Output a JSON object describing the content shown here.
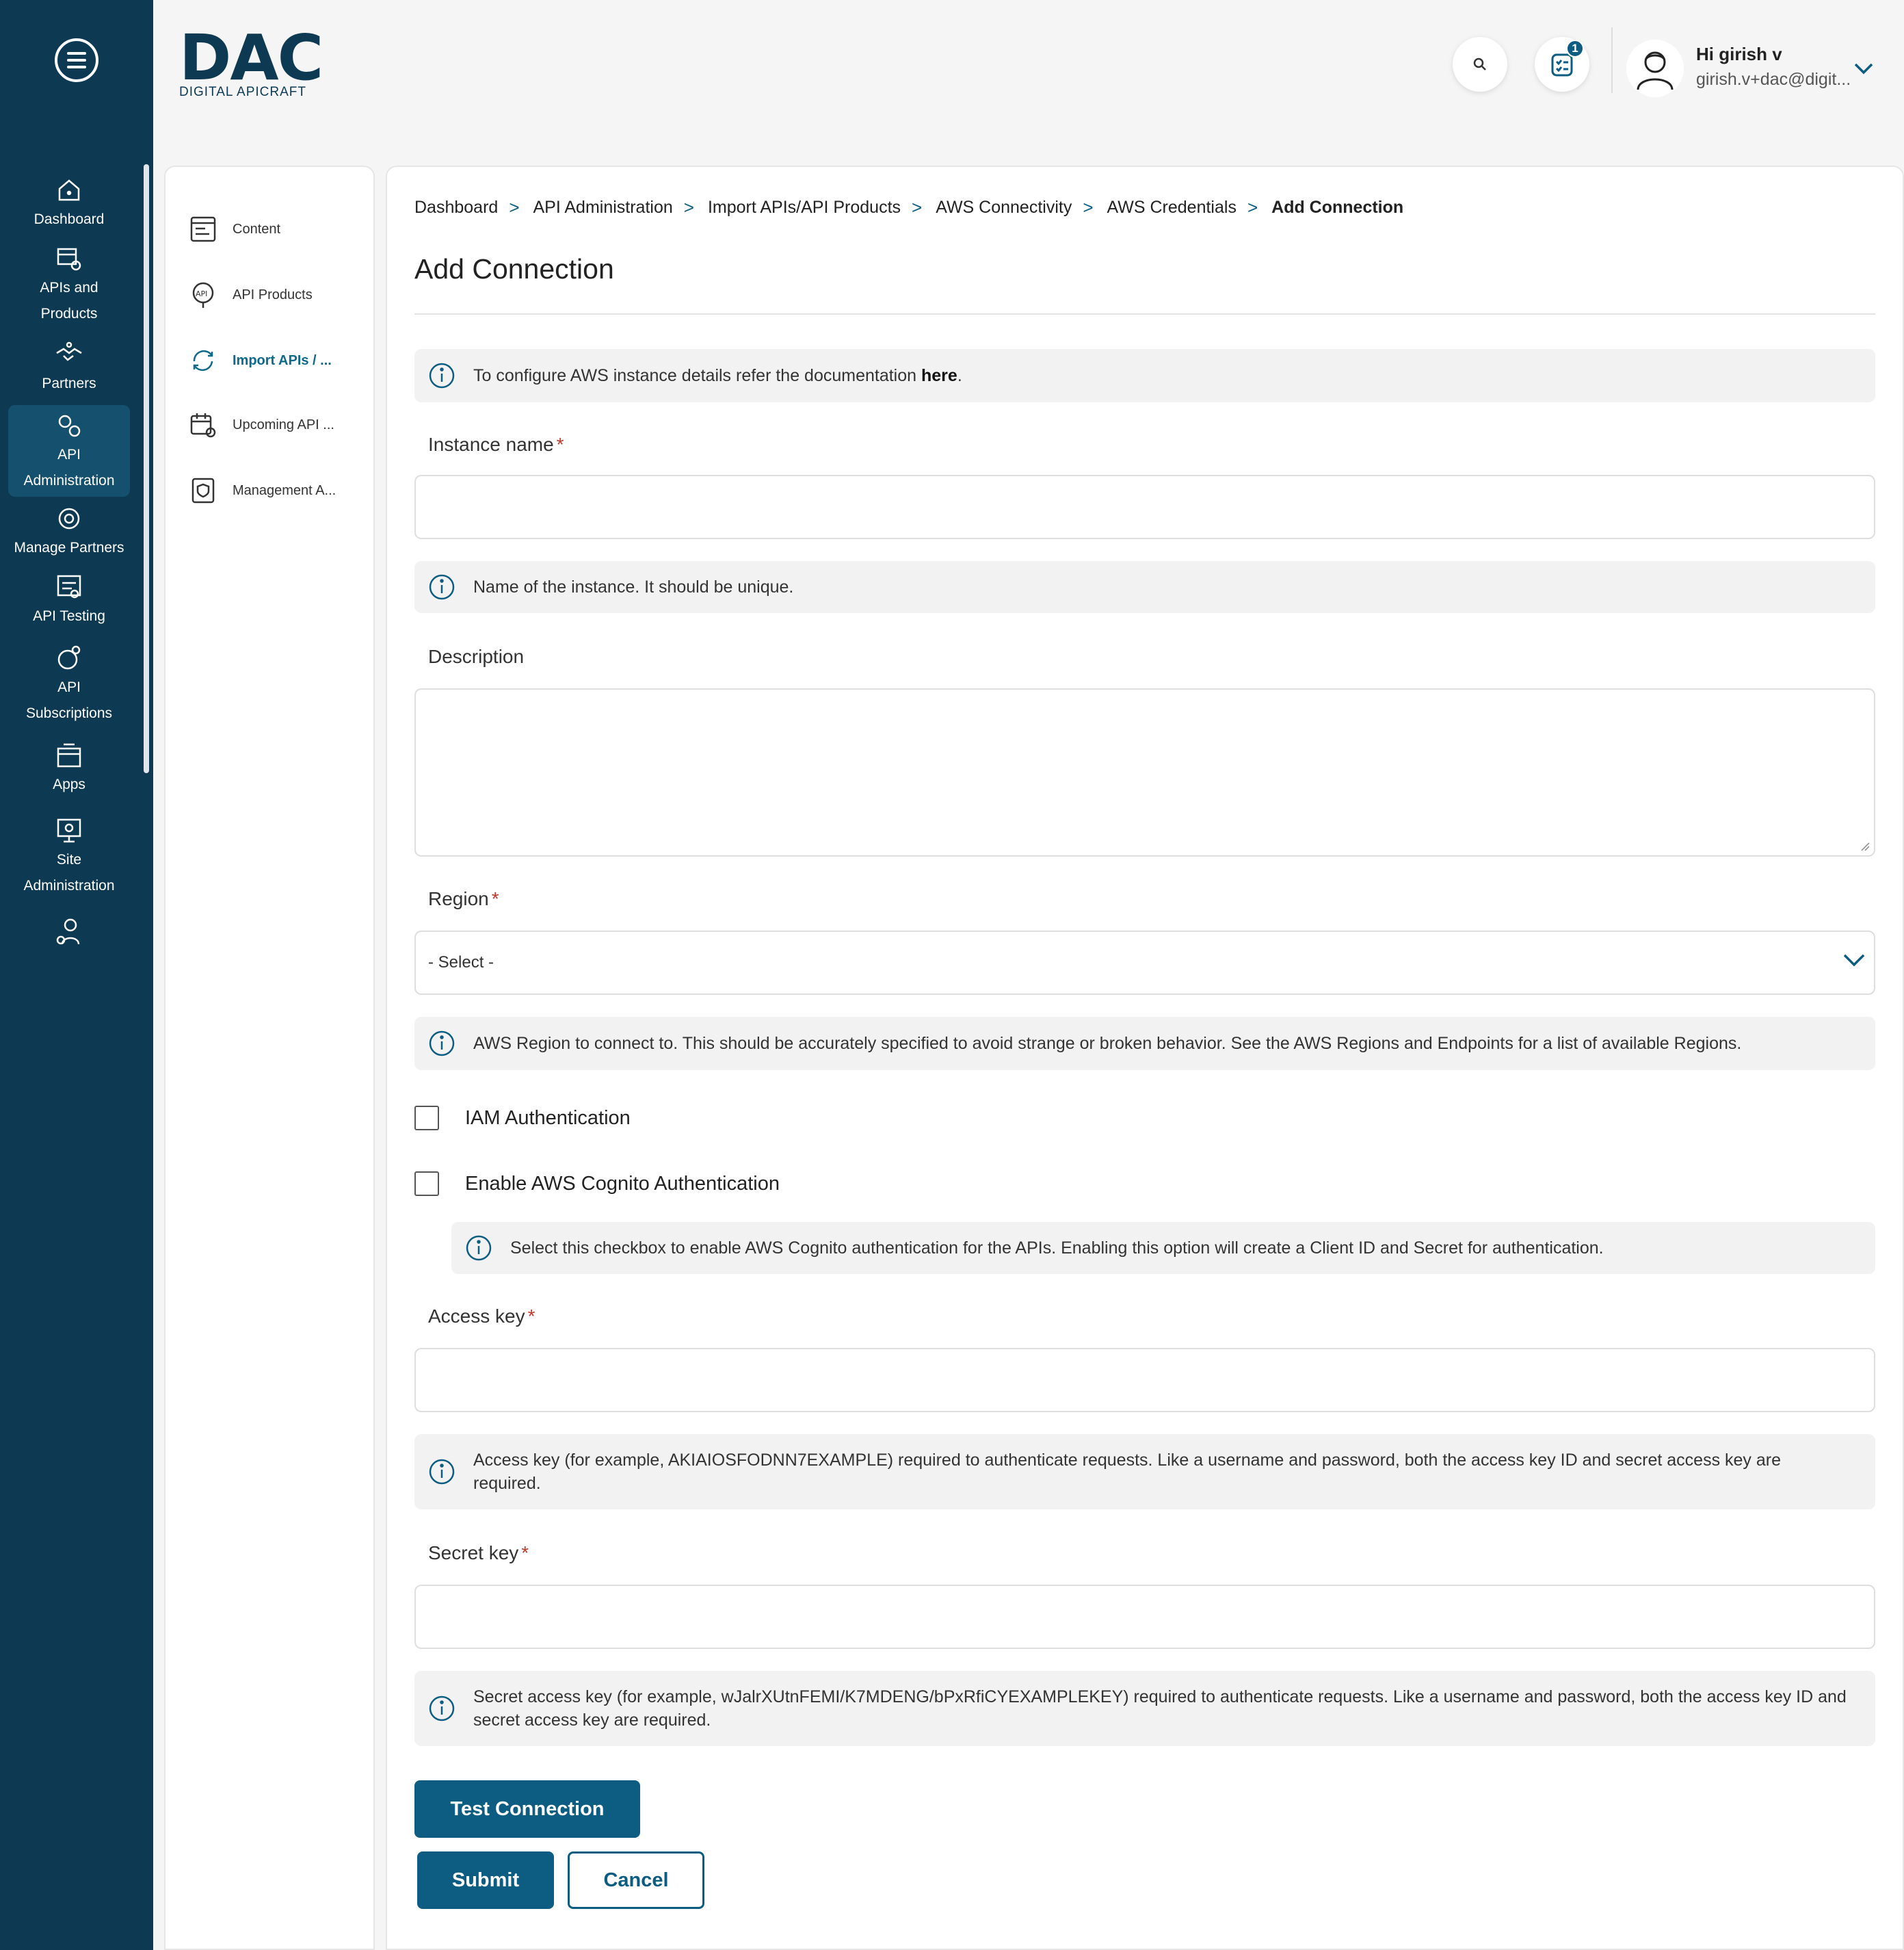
{
  "nav": {
    "items": [
      {
        "label": "Dashboard"
      },
      {
        "label": "APIs and Products"
      },
      {
        "label": "Partners"
      },
      {
        "label": "API Administration"
      },
      {
        "label": "Manage Partners"
      },
      {
        "label": "API Testing"
      },
      {
        "label": "API Subscriptions"
      },
      {
        "label": "Apps"
      },
      {
        "label": "Site Administration"
      }
    ]
  },
  "logo": {
    "main": "DAC",
    "sub": "DIGITAL APICRAFT"
  },
  "header": {
    "notification_count": "1",
    "user_greeting": "Hi girish v",
    "user_email": "girish.v+dac@digit..."
  },
  "subnav": {
    "items": [
      {
        "label": "Content"
      },
      {
        "label": "API Products"
      },
      {
        "label": "Import APIs / ..."
      },
      {
        "label": "Upcoming API ..."
      },
      {
        "label": "Management A..."
      }
    ]
  },
  "breadcrumb": [
    "Dashboard",
    "API Administration",
    "Import APIs/API Products",
    "AWS Connectivity",
    "AWS Credentials",
    "Add Connection"
  ],
  "page_title": "Add Connection",
  "docs_info": {
    "text": "To configure AWS instance details refer the documentation ",
    "link": "here",
    "suffix": "."
  },
  "form": {
    "instance_name": {
      "label": "Instance name",
      "required": "*",
      "value": "",
      "help": "Name of the instance. It should be unique."
    },
    "description": {
      "label": "Description",
      "value": ""
    },
    "region": {
      "label": "Region",
      "required": "*",
      "selected": "- Select -",
      "help": "AWS Region to connect to. This should be accurately specified to avoid strange or broken behavior. See the AWS Regions and Endpoints for a list of available Regions."
    },
    "iam_auth": {
      "label": "IAM Authentication",
      "checked": false
    },
    "cognito_auth": {
      "label": "Enable AWS Cognito Authentication",
      "checked": false,
      "help": "Select this checkbox to enable AWS Cognito authentication for the APIs. Enabling this option will create a Client ID and Secret for authentication."
    },
    "access_key": {
      "label": "Access key",
      "required": "*",
      "value": "",
      "help": "Access key (for example, AKIAIOSFODNN7EXAMPLE) required to authenticate requests. Like a username and password, both the access key ID and secret access key are required."
    },
    "secret_key": {
      "label": "Secret key",
      "required": "*",
      "value": "",
      "help": "Secret access key (for example, wJalrXUtnFEMI/K7MDENG/bPxRfiCYEXAMPLEKEY) required to authenticate requests. Like a username and password, both the access key ID and secret access key are required."
    }
  },
  "buttons": {
    "test": "Test Connection",
    "submit": "Submit",
    "cancel": "Cancel"
  },
  "colors": {
    "nav_bg": "#0d3a52",
    "primary": "#0d5c82",
    "required": "#c0392b"
  }
}
